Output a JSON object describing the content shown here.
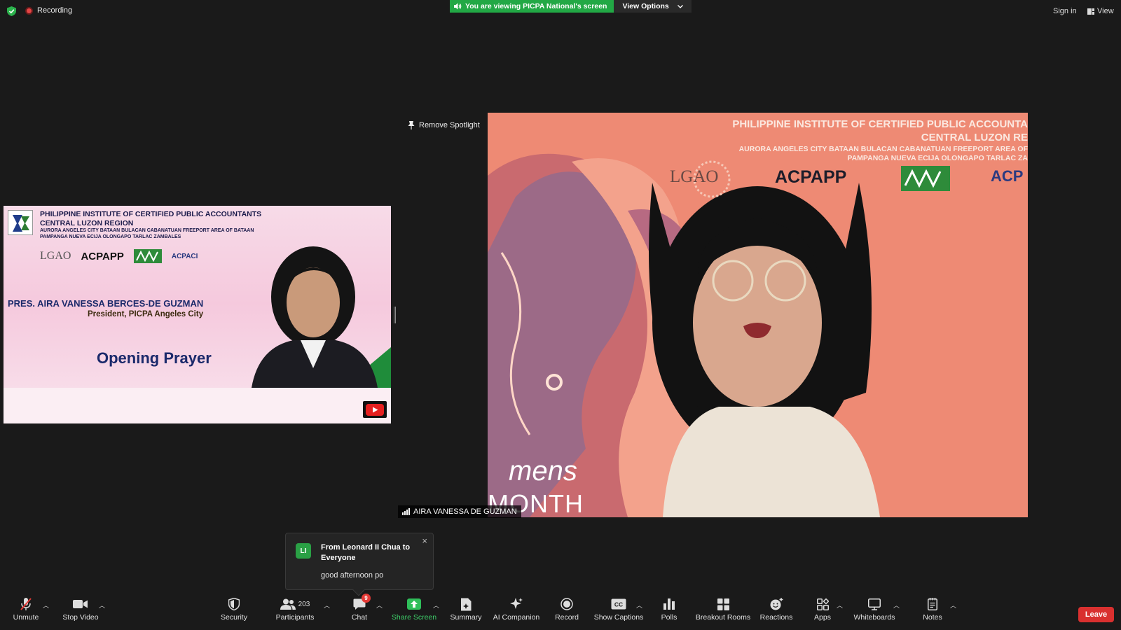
{
  "topbar": {
    "recording_label": "Recording",
    "banner_text": "You are viewing PICPA National's screen",
    "view_options_label": "View Options",
    "sign_in_label": "Sign in",
    "view_label": "View"
  },
  "shared_screen": {
    "org_line1": "PHILIPPINE INSTITUTE OF CERTIFIED PUBLIC ACCOUNTANTS",
    "org_line2": "CENTRAL LUZON REGION",
    "chapters_line1": "AURORA  ANGELES CITY  BATAAN  BULACAN  CABANATUAN  FREEPORT AREA OF BATAAN",
    "chapters_line2": "PAMPANGA  NUEVA ECIJA  OLONGAPO  TARLAC  ZAMBALES",
    "partner_lgao": "LGAO",
    "partner_acpapp": "ACPAPP",
    "partner_acpaci": "ACPACI",
    "speaker_name": "PRES. AIRA VANESSA BERCES-DE GUZMAN",
    "speaker_role": "President, PICPA Angeles City",
    "segment_title": "Opening Prayer"
  },
  "spotlight": {
    "remove_label": "Remove Spotlight"
  },
  "video": {
    "header_line1": "PHILIPPINE INSTITUTE OF CERTIFIED PUBLIC ACCOUNTA",
    "header_line2": "CENTRAL LUZON RE",
    "chapters_line1": "AURORA ANGELES CITY BATAAN BULACAN CABANATUAN FREEPORT AREA OF",
    "chapters_line2": "PAMPANGA NUEVA ECIJA OLONGAPO TARLAC ZA",
    "partner_lgao": "LGAO",
    "partner_acpapp": "ACPAPP",
    "partner_acp": "ACP",
    "bg_text_mens": "mens",
    "bg_text_month": "MONTH",
    "participant_name": "AIRA VANESSA DE GUZMAN"
  },
  "chat_toast": {
    "avatar_initials": "LI",
    "from_text": "From Leonard II Chua to Everyone",
    "message": "good afternoon po"
  },
  "toolbar": {
    "unmute": "Unmute",
    "stop_video": "Stop Video",
    "security": "Security",
    "participants": "Participants",
    "participants_count": "203",
    "chat": "Chat",
    "chat_badge": "9",
    "share_screen": "Share Screen",
    "summary": "Summary",
    "ai_companion": "AI Companion",
    "record": "Record",
    "show_captions": "Show Captions",
    "polls": "Polls",
    "breakout_rooms": "Breakout Rooms",
    "reactions": "Reactions",
    "apps": "Apps",
    "whiteboards": "Whiteboards",
    "notes": "Notes",
    "leave": "Leave"
  },
  "colors": {
    "background": "#1a1a1a",
    "banner_green": "#22a845",
    "leave_red": "#d9302f",
    "share_green": "#3ecf6a",
    "video_bg": "#ef8c78"
  },
  "icons": {
    "shield": "shield-check-icon",
    "record_dot": "record-dot-icon",
    "speaker": "speaker-icon",
    "chevron": "chevron-down-icon",
    "pin": "pin-icon",
    "signal": "signal-bars-icon"
  }
}
